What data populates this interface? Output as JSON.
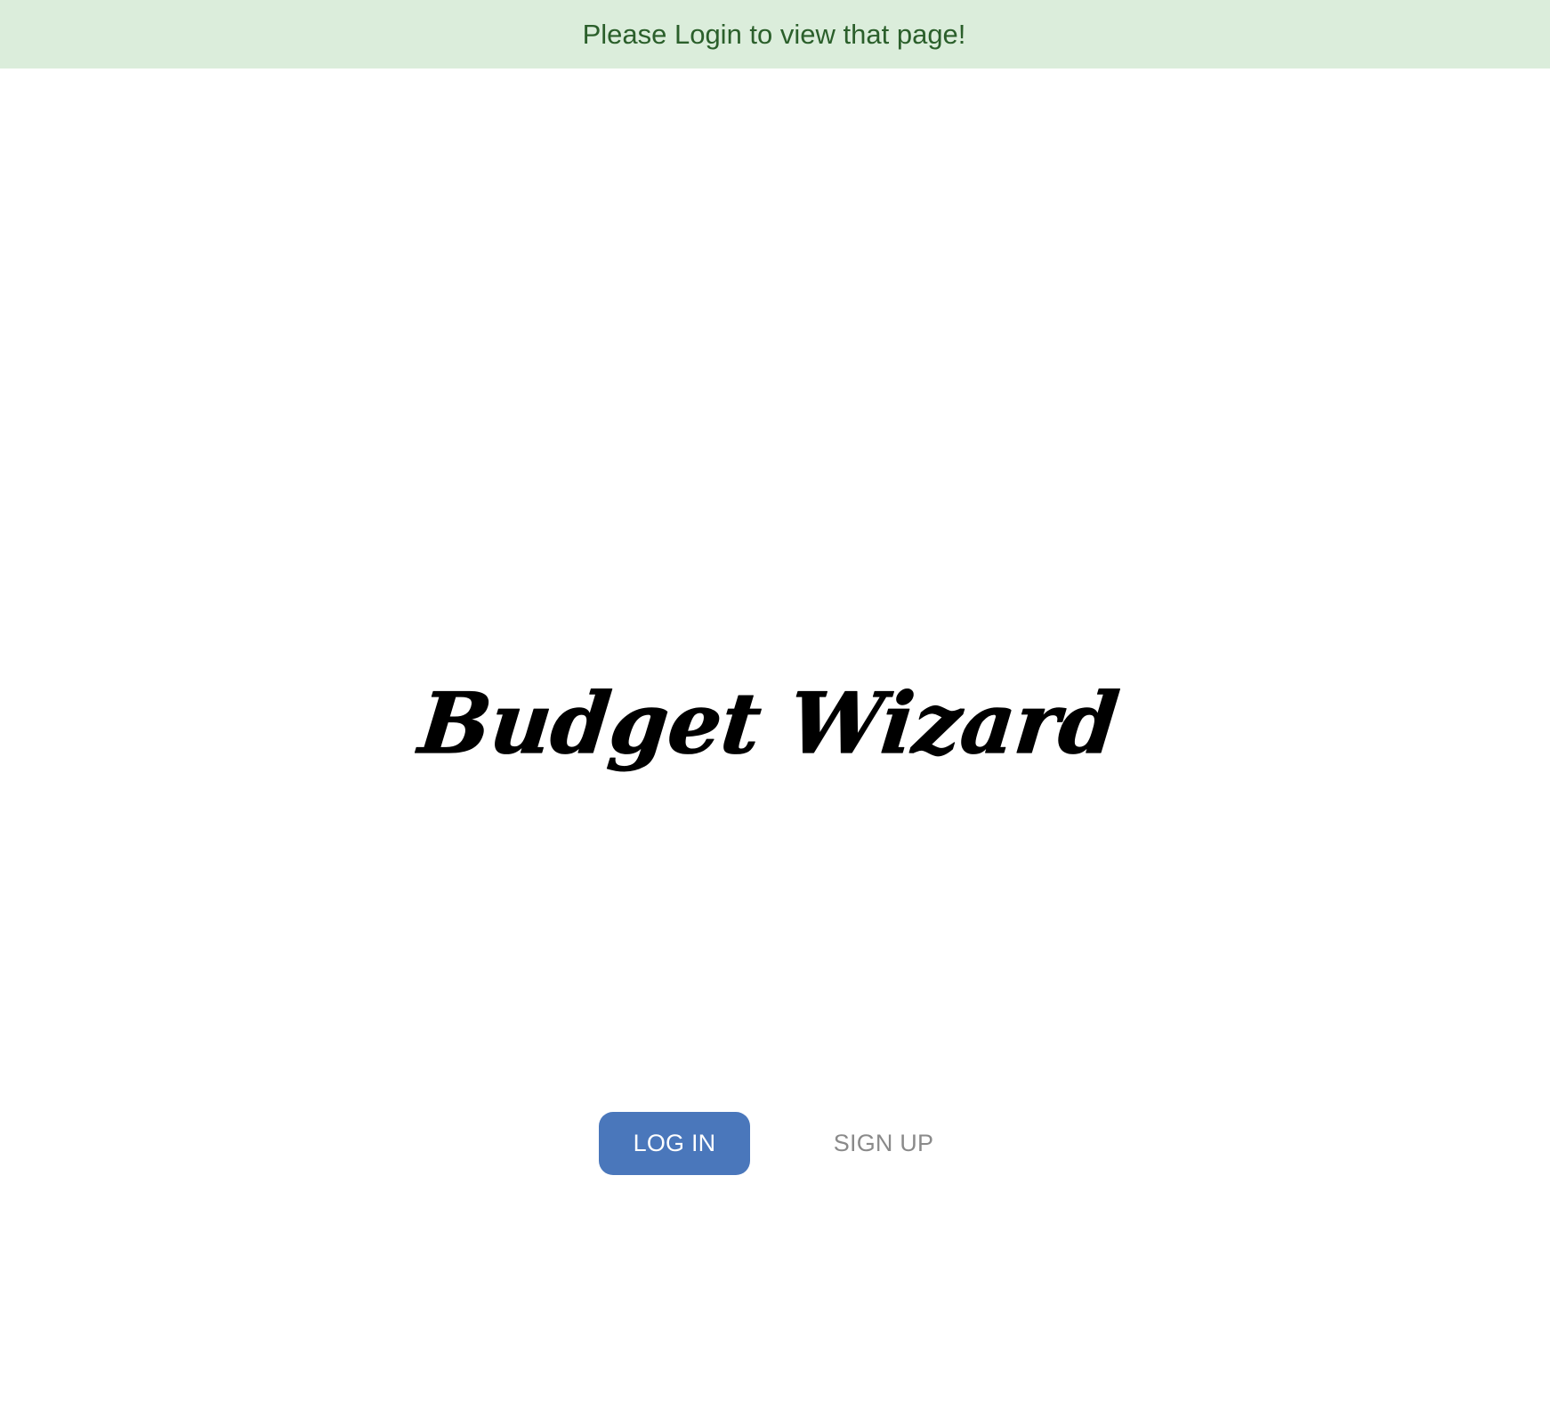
{
  "flash": {
    "message": "Please Login to view that page!",
    "background": "#dbeddb",
    "text_color": "#2b5f2b"
  },
  "logo": {
    "text": "Budget Wizard"
  },
  "actions": {
    "login_label": "LOG IN",
    "signup_label": "SIGN UP",
    "login_color": "#4a77bb",
    "signup_color": "#8a8a8a"
  }
}
